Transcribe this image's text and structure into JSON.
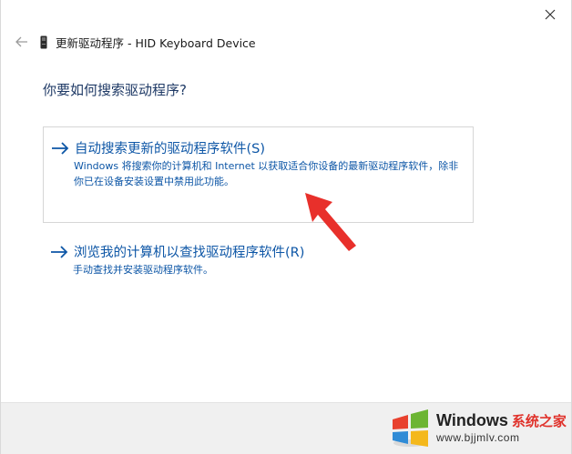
{
  "window": {
    "title": "更新驱动程序 - HID Keyboard Device"
  },
  "icons": {
    "close": "close-icon",
    "back": "back-arrow-icon",
    "device": "keyboard-device-icon",
    "option_arrow": "right-arrow-icon",
    "annotation": "red-pointer-arrow",
    "watermark_logo": "windows-logo-icon"
  },
  "main": {
    "heading": "你要如何搜索驱动程序?",
    "options": [
      {
        "title": "自动搜索更新的驱动程序软件(S)",
        "description": "Windows 将搜索你的计算机和 Internet 以获取适合你设备的最新驱动程序软件，除非你已在设备安装设置中禁用此功能。"
      },
      {
        "title": "浏览我的计算机以查找驱动程序软件(R)",
        "description": "手动查找并安装驱动程序软件。"
      }
    ]
  },
  "watermark": {
    "brand": "Windows",
    "brand_cn": "系统之家",
    "url": "www.bjjmlv.com"
  },
  "colors": {
    "link_blue": "#0d56a6",
    "heading_blue": "#1f3a66",
    "annotation_red": "#e8302b",
    "footer_gray": "#f0f0f0"
  }
}
